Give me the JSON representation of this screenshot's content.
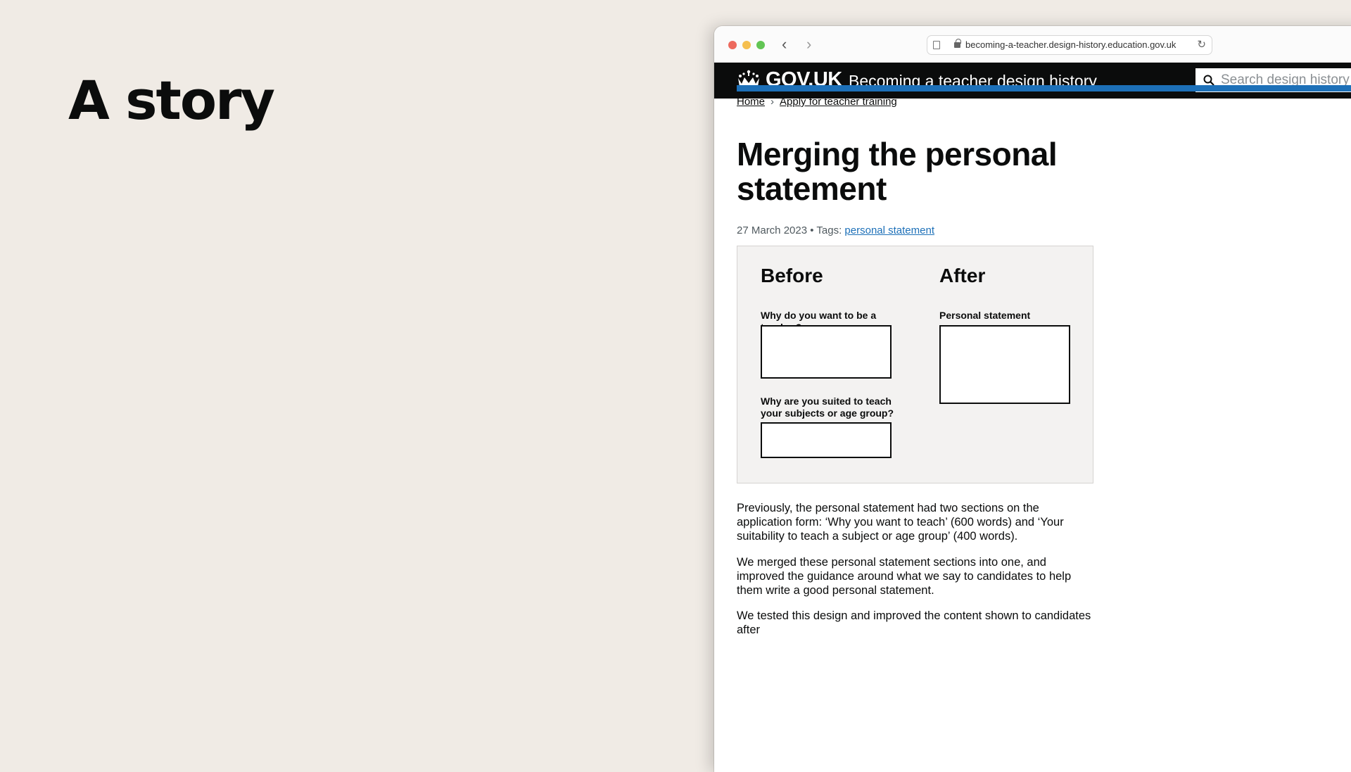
{
  "slide": {
    "title": "A story"
  },
  "browser": {
    "url": "becoming-a-teacher.design-history.education.gov.uk"
  },
  "header": {
    "logo_text": "GOV.UK",
    "service_name": "Becoming a teacher design history",
    "search_placeholder": "Search design history"
  },
  "breadcrumb": {
    "items": [
      "Home",
      "Apply for teacher training"
    ]
  },
  "article": {
    "title": "Merging the personal statement",
    "date": "27 March 2023",
    "tags_label": "• Tags:",
    "tag": "personal statement"
  },
  "comparison": {
    "before": {
      "heading": "Before",
      "fields": [
        "Why do you want to be a teacher?",
        "Why are you suited to teach your subjects or age group?"
      ]
    },
    "after": {
      "heading": "After",
      "fields": [
        "Personal statement"
      ]
    }
  },
  "body": {
    "paragraphs": [
      "Previously, the personal statement had two sections on the application form: ‘Why you want to teach’ (600 words) and ‘Your suitability to teach a subject or age group’ (400 words).",
      "We merged these personal statement sections into one, and improved the guidance around what we say to candidates to help them write a good personal statement.",
      "We tested this design and improved the content shown to candidates after"
    ]
  }
}
